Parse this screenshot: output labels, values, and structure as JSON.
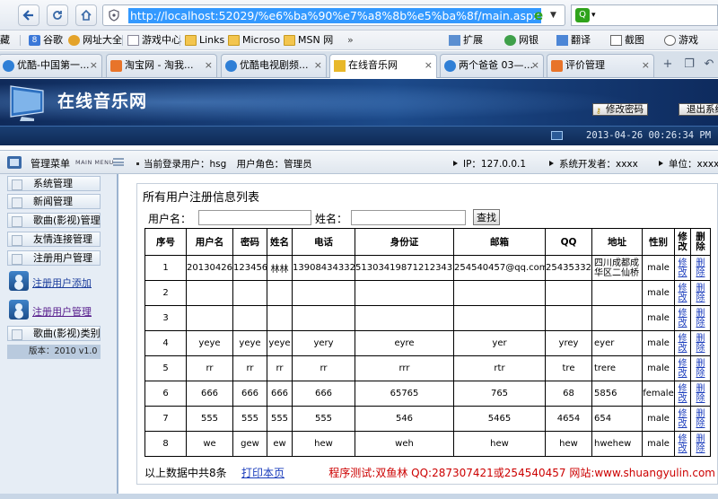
{
  "browser": {
    "url": "http://localhost:52029/%e6%ba%90%e7%a8%8b%e5%ba%8f/main.aspx",
    "bookmarks": [
      {
        "label": "藏",
        "icon": "none"
      },
      {
        "label": "谷歌",
        "icon": "google-icon"
      },
      {
        "label": "网址大全",
        "icon": "web-icon"
      },
      {
        "label": "游戏中心",
        "icon": "page-icon"
      },
      {
        "label": "Links",
        "icon": "folder-icon"
      },
      {
        "label": "Microso",
        "icon": "folder-icon"
      },
      {
        "label": "MSN 网",
        "icon": "folder-icon"
      }
    ],
    "toolbar": {
      "expand": "扩展",
      "netbank": "网银",
      "translate": "翻译",
      "screenshot": "截图",
      "game": "游戏"
    },
    "tabs": [
      {
        "label": "优酷-中国第一...",
        "color": "#2f7fd6",
        "active": false
      },
      {
        "label": "淘宝网 - 淘我...",
        "color": "#e8742a",
        "active": false
      },
      {
        "label": "优酷电视剧频...",
        "color": "#2f7fd6",
        "active": false
      },
      {
        "label": "在线音乐网",
        "color": "#e8b82a",
        "active": true
      },
      {
        "label": "两个爸爸 03—...",
        "color": "#2f7fd6",
        "active": false
      },
      {
        "label": "评价管理",
        "color": "#e8742a",
        "active": false
      }
    ]
  },
  "site": {
    "title": "在线音乐网",
    "change_password": "修改密码",
    "logout": "退出系统",
    "datetime": "2013-04-26 00:26:34 PM"
  },
  "info": {
    "menu_title": "管理菜单",
    "menu_title_en": "MAIN MENU",
    "current_user_label": "当前登录用户：",
    "current_user": "hsg",
    "role_label": "用户角色：",
    "role": "管理员",
    "ip": "IP：127.0.0.1",
    "developer": "系统开发者：xxxx",
    "unit": "单位：xxxx"
  },
  "sidebar": {
    "items": [
      "系统管理",
      "新闻管理",
      "歌曲(影视)管理",
      "友情连接管理",
      "注册用户管理"
    ],
    "subitems": [
      "注册用户添加",
      "注册用户管理"
    ],
    "last_item": "歌曲(影视)类别",
    "version": "版本：2010 v1.0"
  },
  "main": {
    "panel_title": "所有用户注册信息列表",
    "filter": {
      "username_label": "用户名：",
      "name_label": "姓名：",
      "search_button": "查找"
    },
    "columns": [
      "序号",
      "用户名",
      "密码",
      "姓名",
      "电话",
      "身份证",
      "邮箱",
      "QQ",
      "地址",
      "性别",
      "修改",
      "删除"
    ],
    "edit_text": "修改",
    "delete_text": "删除",
    "rows": [
      {
        "no": "1",
        "username": "20130426",
        "password": "123456",
        "name": "林林",
        "phone": "13908434332",
        "idcard": "513034198712123433",
        "email": "254540457@qq.com",
        "qq": "25435332",
        "address": "四川成都成华区二仙桥",
        "gender": "male"
      },
      {
        "no": "2",
        "username": "",
        "password": "",
        "name": "",
        "phone": "",
        "idcard": "",
        "email": "",
        "qq": "",
        "address": "",
        "gender": "male"
      },
      {
        "no": "3",
        "username": "",
        "password": "",
        "name": "",
        "phone": "",
        "idcard": "",
        "email": "",
        "qq": "",
        "address": "",
        "gender": "male"
      },
      {
        "no": "4",
        "username": "yeye",
        "password": "yeye",
        "name": "yeye",
        "phone": "yery",
        "idcard": "eyre",
        "email": "yer",
        "qq": "yrey",
        "address": "eyer",
        "gender": "male"
      },
      {
        "no": "5",
        "username": "rr",
        "password": "rr",
        "name": "rr",
        "phone": "rr",
        "idcard": "rrr",
        "email": "rtr",
        "qq": "tre",
        "address": "trere",
        "gender": "male"
      },
      {
        "no": "6",
        "username": "666",
        "password": "666",
        "name": "666",
        "phone": "666",
        "idcard": "65765",
        "email": "765",
        "qq": "68",
        "address": "5856",
        "gender": "female"
      },
      {
        "no": "7",
        "username": "555",
        "password": "555",
        "name": "555",
        "phone": "555",
        "idcard": "546",
        "email": "5465",
        "qq": "4654",
        "address": "654",
        "gender": "male"
      },
      {
        "no": "8",
        "username": "we",
        "password": "gew",
        "name": "ew",
        "phone": "hew",
        "idcard": "weh",
        "email": "hew",
        "qq": "hew",
        "address": "hwehew",
        "gender": "male"
      }
    ],
    "summary": "以上数据中共8条",
    "print_link": "打印本页",
    "developer_note": "程序测试:双鱼林 QQ:287307421或254540457 网站:www.shuangyulin.com"
  },
  "colors": {
    "header_dark": "#0f2a5a",
    "link": "#1a3cbc",
    "note_red": "#cc0000"
  }
}
